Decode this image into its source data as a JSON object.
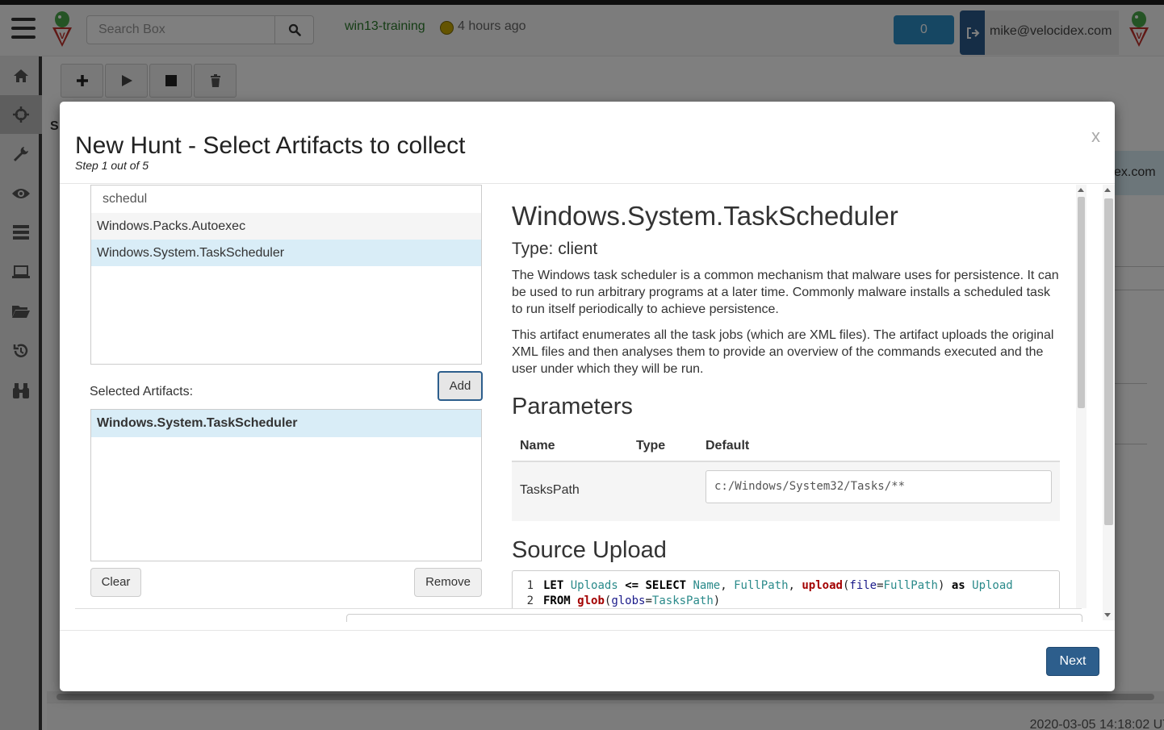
{
  "app": {
    "search_placeholder": "Search Box",
    "client_name": "win13-training",
    "last_seen": "4 hours ago",
    "notification_count": "0",
    "user_email": "mike@velocidex.com",
    "bg_email_fragment": "ex.com",
    "bg_header_fragment": "S",
    "timestamp": "2020-03-05 14:18:02 UT",
    "status_color": "#c8a800",
    "accent_color": "#2d5e8c",
    "sidebar_icons": [
      "home-icon",
      "crosshairs-icon",
      "wrench-icon",
      "eye-icon",
      "server-icon",
      "laptop-icon",
      "folder-icon",
      "history-icon",
      "binoculars-icon"
    ],
    "toolbar_icons": [
      "plus-icon",
      "play-icon",
      "stop-icon",
      "trash-icon"
    ]
  },
  "modal": {
    "title": "New Hunt - Select Artifacts to collect",
    "step": "Step 1 out of 5",
    "close_label": "x",
    "filter_value": "schedul",
    "artifacts": [
      {
        "name": "Windows.Packs.Autoexec",
        "selected": false
      },
      {
        "name": "Windows.System.TaskScheduler",
        "selected": true
      }
    ],
    "add_label": "Add",
    "selected_label": "Selected Artifacts:",
    "selected_artifacts": [
      "Windows.System.TaskScheduler"
    ],
    "clear_label": "Clear",
    "remove_label": "Remove",
    "next_label": "Next"
  },
  "detail": {
    "title": "Windows.System.TaskScheduler",
    "type": "Type: client",
    "description_1": "The Windows task scheduler is a common mechanism that malware uses for persistence. It can be used to run arbitrary programs at a later time. Commonly malware installs a scheduled task to run itself periodically to achieve persistence.",
    "description_2": "This artifact enumerates all the task jobs (which are XML files). The artifact uploads the original XML files and then analyses them to provide an overview of the commands executed and the user under which they will be run.",
    "parameters_heading": "Parameters",
    "param_headers": {
      "name": "Name",
      "type": "Type",
      "default": "Default"
    },
    "params": [
      {
        "name": "TasksPath",
        "type": "",
        "default": "c:/Windows/System32/Tasks/**"
      }
    ],
    "source_heading": "Source Upload",
    "code_lines": [
      "LET Uploads <= SELECT Name, FullPath, upload(file=FullPath) as Upload",
      "FROM glob(globs=TasksPath)"
    ]
  }
}
